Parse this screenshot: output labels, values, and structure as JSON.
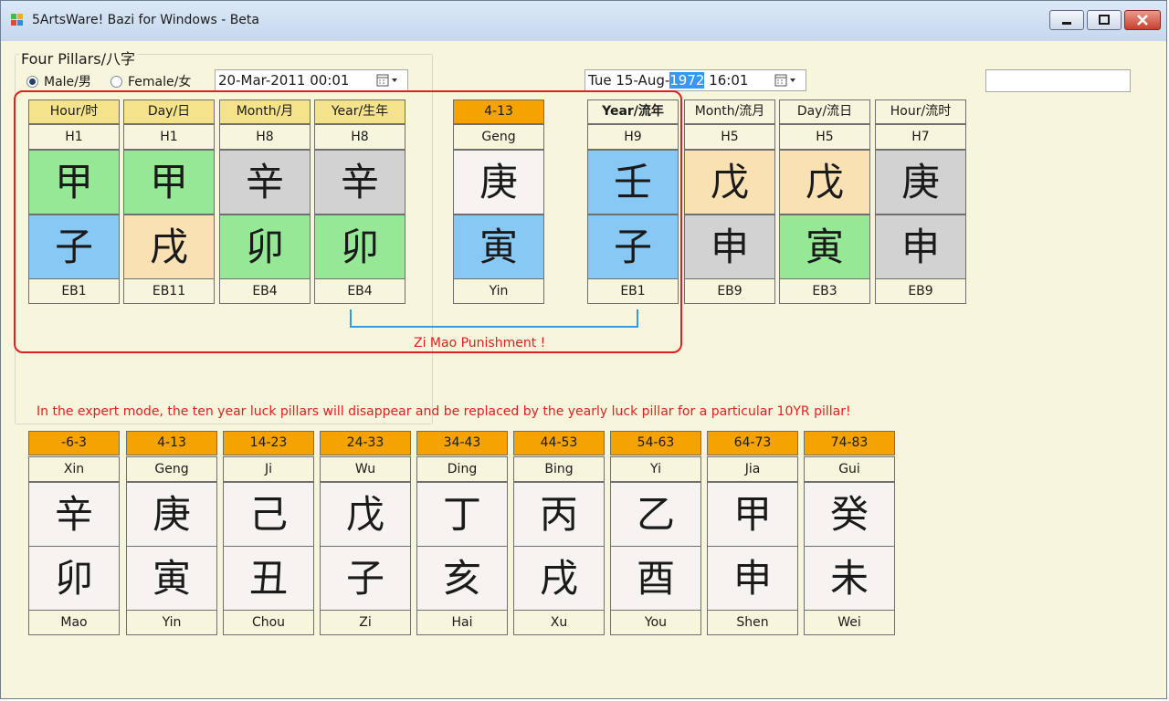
{
  "window": {
    "title": "5ArtsWare! Bazi for Windows - Beta"
  },
  "group": {
    "title": "Four Pillars/八字"
  },
  "gender": {
    "male": "Male/男",
    "female": "Female/女",
    "selected": "male"
  },
  "birth_date": "20-Mar-2011 00:01",
  "flow_date": {
    "prefix": "Tue  15-Aug-",
    "year": "1972",
    "suffix": " 16:01"
  },
  "natal": [
    {
      "header": "Hour/时",
      "stem_code": "H1",
      "stem": "甲",
      "branch": "子",
      "branch_code": "EB1"
    },
    {
      "header": "Day/日",
      "stem_code": "H1",
      "stem": "甲",
      "branch": "戌",
      "branch_code": "EB11"
    },
    {
      "header": "Month/月",
      "stem_code": "H8",
      "stem": "辛",
      "branch": "卯",
      "branch_code": "EB4"
    },
    {
      "header": "Year/生年",
      "stem_code": "H8",
      "stem": "辛",
      "branch": "卯",
      "branch_code": "EB4"
    }
  ],
  "current_luck": {
    "header": "4-13",
    "stem_name": "Geng",
    "stem": "庚",
    "branch": "寅",
    "branch_name": "Yin"
  },
  "flow": [
    {
      "header": "Year/流年",
      "stem_code": "H9",
      "stem": "壬",
      "branch": "子",
      "branch_code": "EB1"
    },
    {
      "header": "Month/流月",
      "stem_code": "H5",
      "stem": "戊",
      "branch": "申",
      "branch_code": "EB9"
    },
    {
      "header": "Day/流日",
      "stem_code": "H5",
      "stem": "戊",
      "branch": "寅",
      "branch_code": "EB3"
    },
    {
      "header": "Hour/流时",
      "stem_code": "H7",
      "stem": "庚",
      "branch": "申",
      "branch_code": "EB9"
    }
  ],
  "punishment": "Zi Mao Punishment !",
  "note": "In the expert mode, the ten year luck pillars will disappear and be replaced by the yearly luck pillar for a particular 10YR pillar!",
  "luck_pillars": [
    {
      "range": "-6-3",
      "stem_name": "Xin",
      "stem": "辛",
      "branch": "卯",
      "branch_name": "Mao"
    },
    {
      "range": "4-13",
      "stem_name": "Geng",
      "stem": "庚",
      "branch": "寅",
      "branch_name": "Yin"
    },
    {
      "range": "14-23",
      "stem_name": "Ji",
      "stem": "己",
      "branch": "丑",
      "branch_name": "Chou"
    },
    {
      "range": "24-33",
      "stem_name": "Wu",
      "stem": "戊",
      "branch": "子",
      "branch_name": "Zi"
    },
    {
      "range": "34-43",
      "stem_name": "Ding",
      "stem": "丁",
      "branch": "亥",
      "branch_name": "Hai"
    },
    {
      "range": "44-53",
      "stem_name": "Bing",
      "stem": "丙",
      "branch": "戌",
      "branch_name": "Xu"
    },
    {
      "range": "54-63",
      "stem_name": "Yi",
      "stem": "乙",
      "branch": "酉",
      "branch_name": "You"
    },
    {
      "range": "64-73",
      "stem_name": "Jia",
      "stem": "甲",
      "branch": "申",
      "branch_name": "Shen"
    },
    {
      "range": "74-83",
      "stem_name": "Gui",
      "stem": "癸",
      "branch": "未",
      "branch_name": "Wei"
    }
  ],
  "colors": {
    "wood": "#96e896",
    "water": "#88c8f5",
    "earth": "#fae1b4",
    "metal": "#d3d2d2",
    "fire": "#f6f3f1",
    "header": "#f5e38c",
    "luck_header": "#f5a300",
    "background": "#f7f5dc",
    "alert": "#e02020"
  }
}
